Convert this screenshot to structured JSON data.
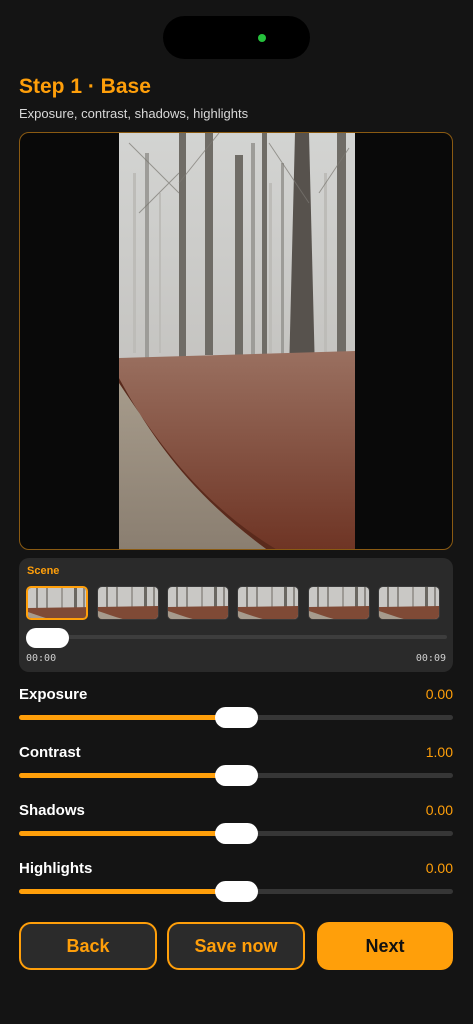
{
  "header": {
    "title": "Step 1 · Base",
    "subtitle": "Exposure, contrast, shadows, highlights"
  },
  "preview": {
    "image": "foggy-forest-path-photo"
  },
  "scene": {
    "label": "Scene",
    "thumbnails": [
      {
        "name": "scene-thumb-1",
        "selected": true
      },
      {
        "name": "scene-thumb-2",
        "selected": false
      },
      {
        "name": "scene-thumb-3",
        "selected": false
      },
      {
        "name": "scene-thumb-4",
        "selected": false
      },
      {
        "name": "scene-thumb-5",
        "selected": false
      },
      {
        "name": "scene-thumb-6",
        "selected": false
      }
    ],
    "start_time": "00:00",
    "end_time": "00:09",
    "scrub_position_fraction": 0.0
  },
  "sliders": [
    {
      "label": "Exposure",
      "value": "0.00",
      "level_fraction": 0.5
    },
    {
      "label": "Contrast",
      "value": "1.00",
      "level_fraction": 0.5
    },
    {
      "label": "Shadows",
      "value": "0.00",
      "level_fraction": 0.5
    },
    {
      "label": "Highlights",
      "value": "0.00",
      "level_fraction": 0.5
    }
  ],
  "buttons": {
    "back": "Back",
    "save": "Save now",
    "next": "Next"
  },
  "colors": {
    "accent": "#ff9f0a",
    "background": "#141414",
    "panel": "#2a2a2a",
    "status_dot": "#25c13c"
  }
}
